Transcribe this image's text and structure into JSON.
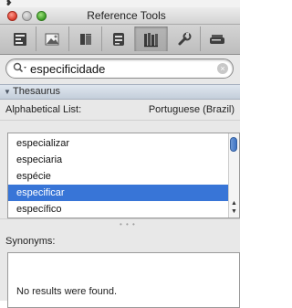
{
  "top": {
    "mark": "❥"
  },
  "window": {
    "title": "Reference Tools"
  },
  "toolbar": {
    "buttons": [
      {
        "icon": "inspector-icon"
      },
      {
        "icon": "images-icon"
      },
      {
        "icon": "contents-icon"
      },
      {
        "icon": "database-icon"
      },
      {
        "icon": "reference-books-icon",
        "active": true
      },
      {
        "icon": "wrench-icon"
      },
      {
        "icon": "drive-icon"
      }
    ]
  },
  "search": {
    "value": "especificidade",
    "placeholder": ""
  },
  "thesaurus": {
    "section_label": "Thesaurus",
    "list_label": "Alphabetical List:",
    "language": "Portuguese (Brazil)",
    "items": [
      "especializar",
      "especiaria",
      "espécie",
      "especificar",
      "específico"
    ],
    "selected_index": 3,
    "splitter": "• • •",
    "synonyms_label": "Synonyms:",
    "no_results": "No results were found."
  }
}
